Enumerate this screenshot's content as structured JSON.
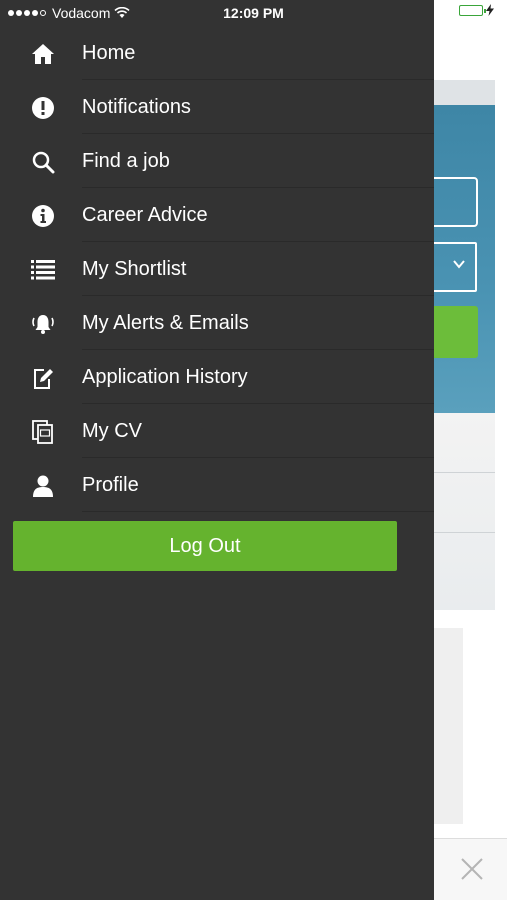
{
  "status_bar": {
    "carrier": "Vodacom",
    "time": "12:09 PM"
  },
  "menu": {
    "items": [
      {
        "label": "Home",
        "icon": "home-icon"
      },
      {
        "label": "Notifications",
        "icon": "exclamation-icon"
      },
      {
        "label": "Find a job",
        "icon": "search-icon"
      },
      {
        "label": "Career Advice",
        "icon": "info-icon"
      },
      {
        "label": "My Shortlist",
        "icon": "list-icon"
      },
      {
        "label": "My Alerts & Emails",
        "icon": "bell-alert-icon"
      },
      {
        "label": "Application History",
        "icon": "edit-document-icon"
      },
      {
        "label": "My CV",
        "icon": "cv-document-icon"
      },
      {
        "label": "Profile",
        "icon": "user-icon"
      }
    ],
    "logout_label": "Log Out"
  },
  "colors": {
    "drawer_bg": "#333333",
    "accent_green": "#65b32e",
    "hero_blue": "#4a93b3"
  }
}
